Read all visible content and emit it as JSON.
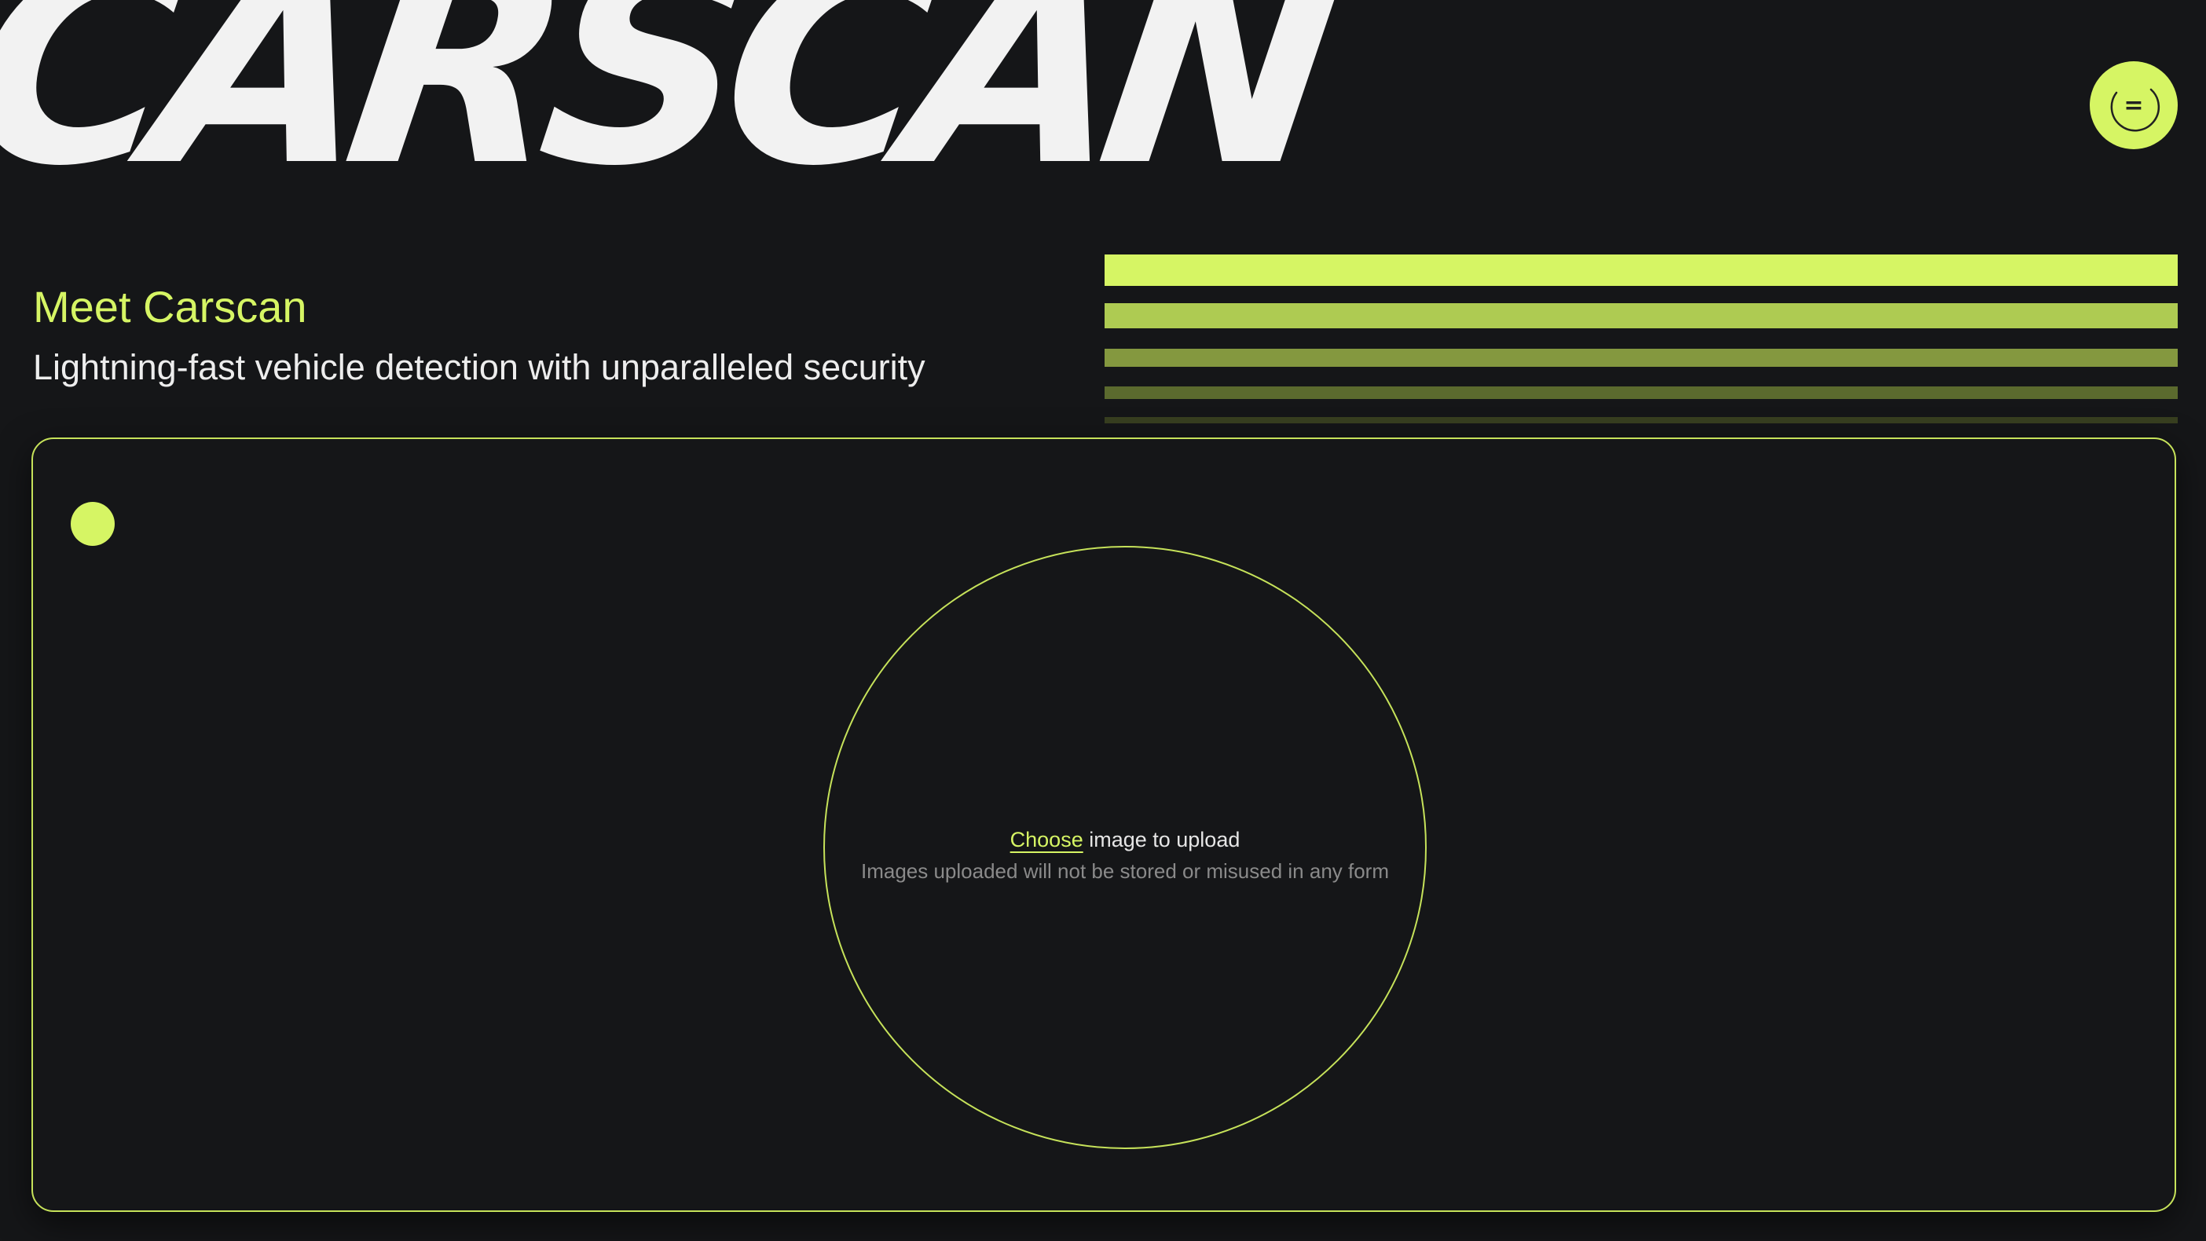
{
  "brand": {
    "logo_text": "CARSCAN"
  },
  "header": {
    "menu_button_label": "=",
    "menu_icon": "menu-icon"
  },
  "hero": {
    "title": "Meet Carscan",
    "subtitle": "Lightning-fast vehicle detection with unparalleled security"
  },
  "decor": {
    "stripe_colors": [
      "#d6f564",
      "#aecb52",
      "#84983f",
      "#5b6a2e",
      "#383f20"
    ]
  },
  "upload": {
    "choose_label": "Choose",
    "prompt_rest": " image to upload",
    "privacy_note": "Images uploaded will not be stored or misused in any form",
    "status_indicator_color": "#d6f564"
  },
  "colors": {
    "background": "#151618",
    "accent": "#d6f564",
    "text": "#f2f2f2",
    "muted_text": "#8a8a8a"
  }
}
